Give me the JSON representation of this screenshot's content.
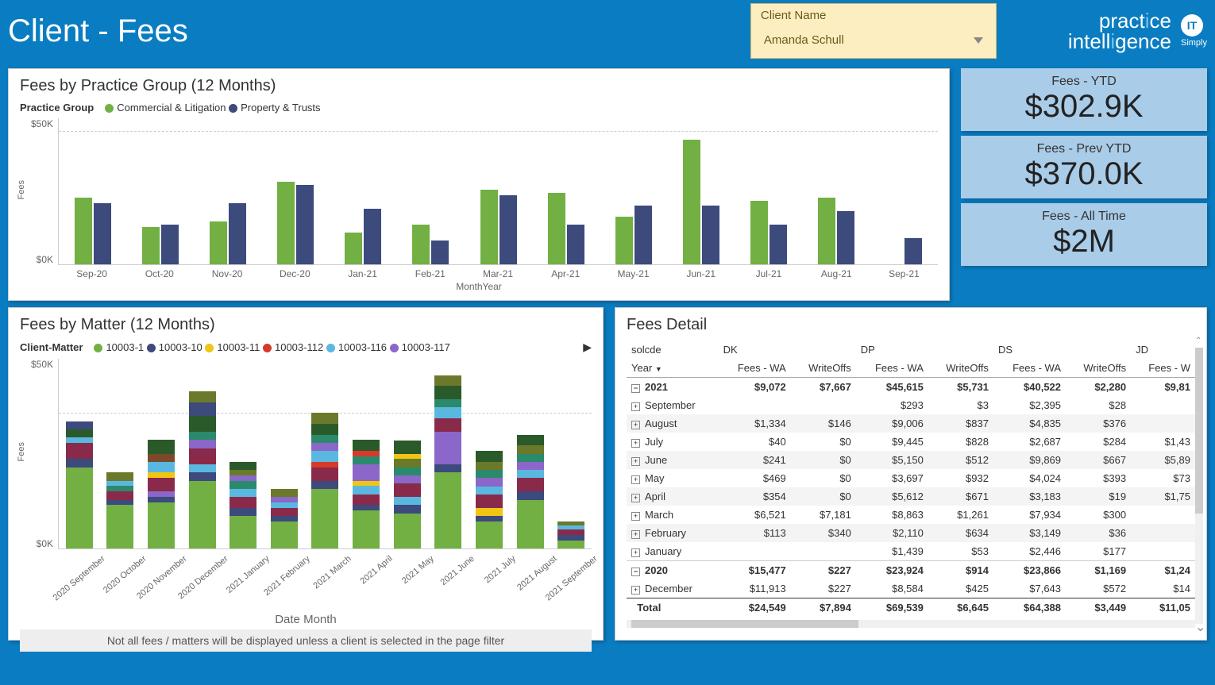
{
  "header": {
    "title": "Client - Fees",
    "filter_label": "Client Name",
    "filter_value": "Amanda Schull",
    "logo_line1_a": "pract",
    "logo_line1_b": "i",
    "logo_line1_c": "ce",
    "logo_line2_a": "intell",
    "logo_line2_b": "i",
    "logo_line2_c": "gence",
    "logo2_top": "IT",
    "logo2_bottom": "Simply"
  },
  "kpi": [
    {
      "title": "Fees - YTD",
      "value": "$302.9K"
    },
    {
      "title": "Fees - Prev YTD",
      "value": "$370.0K"
    },
    {
      "title": "Fees - All Time",
      "value": "$2M"
    }
  ],
  "chart1_title": "Fees by Practice Group (12 Months)",
  "chart1_legend_title": "Practice Group",
  "chart1_xlabel": "MonthYear",
  "chart1_ylabel": "Fees",
  "chart2_title": "Fees by Matter (12 Months)",
  "chart2_legend_title": "Client-Matter",
  "chart2_xlabel": "Date Month",
  "chart2_ylabel": "Fees",
  "chart2_footer": "Not all fees / matters will be displayed unless a client is selected in the page filter",
  "fees_detail_title": "Fees Detail",
  "colors": {
    "green": "#72b043",
    "navy": "#3c4a7c",
    "yellow": "#f0c514",
    "red": "#d63a2a",
    "sky": "#5ab8e0",
    "purple": "#8a67c8",
    "teal": "#2a8a6b",
    "brown": "#7a4a2a",
    "maroon": "#8a2a4a",
    "olive": "#6a7a2a",
    "dkgreen": "#2a5a2a"
  },
  "chart_data": {
    "chart1": {
      "type": "bar",
      "ylabel": "Fees",
      "xlabel": "MonthYear",
      "yticks": [
        "$0K",
        "$50K"
      ],
      "ylim": [
        0,
        55000
      ],
      "categories": [
        "Sep-20",
        "Oct-20",
        "Nov-20",
        "Dec-20",
        "Jan-21",
        "Feb-21",
        "Mar-21",
        "Apr-21",
        "May-21",
        "Jun-21",
        "Jul-21",
        "Aug-21",
        "Sep-21"
      ],
      "series": [
        {
          "name": "Commercial & Litigation",
          "color": "green",
          "values": [
            25000,
            14000,
            16000,
            31000,
            12000,
            15000,
            28000,
            27000,
            18000,
            47000,
            24000,
            25000,
            0
          ]
        },
        {
          "name": "Property & Trusts",
          "color": "navy",
          "values": [
            23000,
            15000,
            23000,
            30000,
            21000,
            9000,
            26000,
            15000,
            22000,
            22000,
            15000,
            20000,
            10000
          ]
        }
      ]
    },
    "chart2": {
      "type": "bar_stacked",
      "ylabel": "Fees",
      "xlabel": "Date Month",
      "yticks": [
        "$0K",
        "$50K"
      ],
      "ylim": [
        0,
        70000
      ],
      "categories": [
        "2020 September",
        "2020 October",
        "2020 November",
        "2020 December",
        "2021 January",
        "2021 February",
        "2021 March",
        "2021 April",
        "2021 May",
        "2021 June",
        "2021 July",
        "2021 August",
        "2021 September"
      ],
      "legend": [
        {
          "name": "10003-1",
          "color": "green"
        },
        {
          "name": "10003-10",
          "color": "navy"
        },
        {
          "name": "10003-11",
          "color": "yellow"
        },
        {
          "name": "10003-112",
          "color": "red"
        },
        {
          "name": "10003-116",
          "color": "sky"
        },
        {
          "name": "10003-117",
          "color": "purple"
        }
      ],
      "stacks": [
        {
          "total": 47000,
          "segs": [
            {
              "c": "green",
              "v": 30000
            },
            {
              "c": "navy",
              "v": 3000
            },
            {
              "c": "maroon",
              "v": 6000
            },
            {
              "c": "sky",
              "v": 2000
            },
            {
              "c": "dkgreen",
              "v": 3000
            },
            {
              "c": "navy",
              "v": 3000
            }
          ]
        },
        {
          "total": 28000,
          "segs": [
            {
              "c": "green",
              "v": 16000
            },
            {
              "c": "navy",
              "v": 2000
            },
            {
              "c": "maroon",
              "v": 3000
            },
            {
              "c": "teal",
              "v": 2000
            },
            {
              "c": "sky",
              "v": 2000
            },
            {
              "c": "olive",
              "v": 3000
            }
          ]
        },
        {
          "total": 40000,
          "segs": [
            {
              "c": "green",
              "v": 17000
            },
            {
              "c": "navy",
              "v": 2000
            },
            {
              "c": "purple",
              "v": 2000
            },
            {
              "c": "maroon",
              "v": 5000
            },
            {
              "c": "yellow",
              "v": 2000
            },
            {
              "c": "sky",
              "v": 4000
            },
            {
              "c": "brown",
              "v": 3000
            },
            {
              "c": "dkgreen",
              "v": 5000
            }
          ]
        },
        {
          "total": 58000,
          "segs": [
            {
              "c": "green",
              "v": 25000
            },
            {
              "c": "navy",
              "v": 3000
            },
            {
              "c": "sky",
              "v": 3000
            },
            {
              "c": "maroon",
              "v": 6000
            },
            {
              "c": "purple",
              "v": 3000
            },
            {
              "c": "teal",
              "v": 3000
            },
            {
              "c": "dkgreen",
              "v": 6000
            },
            {
              "c": "navy",
              "v": 5000
            },
            {
              "c": "olive",
              "v": 4000
            }
          ]
        },
        {
          "total": 32000,
          "segs": [
            {
              "c": "green",
              "v": 12000
            },
            {
              "c": "navy",
              "v": 3000
            },
            {
              "c": "maroon",
              "v": 4000
            },
            {
              "c": "sky",
              "v": 3000
            },
            {
              "c": "teal",
              "v": 3000
            },
            {
              "c": "purple",
              "v": 2000
            },
            {
              "c": "olive",
              "v": 2000
            },
            {
              "c": "dkgreen",
              "v": 3000
            }
          ]
        },
        {
          "total": 22000,
          "segs": [
            {
              "c": "green",
              "v": 10000
            },
            {
              "c": "navy",
              "v": 2000
            },
            {
              "c": "maroon",
              "v": 3000
            },
            {
              "c": "sky",
              "v": 2000
            },
            {
              "c": "purple",
              "v": 2000
            },
            {
              "c": "olive",
              "v": 3000
            }
          ]
        },
        {
          "total": 50000,
          "segs": [
            {
              "c": "green",
              "v": 22000
            },
            {
              "c": "navy",
              "v": 3000
            },
            {
              "c": "maroon",
              "v": 5000
            },
            {
              "c": "red",
              "v": 2000
            },
            {
              "c": "sky",
              "v": 4000
            },
            {
              "c": "purple",
              "v": 3000
            },
            {
              "c": "teal",
              "v": 3000
            },
            {
              "c": "dkgreen",
              "v": 4000
            },
            {
              "c": "olive",
              "v": 4000
            }
          ]
        },
        {
          "total": 40000,
          "segs": [
            {
              "c": "green",
              "v": 14000
            },
            {
              "c": "navy",
              "v": 2000
            },
            {
              "c": "maroon",
              "v": 4000
            },
            {
              "c": "sky",
              "v": 3000
            },
            {
              "c": "yellow",
              "v": 2000
            },
            {
              "c": "purple",
              "v": 6000
            },
            {
              "c": "teal",
              "v": 3000
            },
            {
              "c": "red",
              "v": 2000
            },
            {
              "c": "dkgreen",
              "v": 4000
            }
          ]
        },
        {
          "total": 40000,
          "segs": [
            {
              "c": "green",
              "v": 13000
            },
            {
              "c": "navy",
              "v": 3000
            },
            {
              "c": "sky",
              "v": 3000
            },
            {
              "c": "maroon",
              "v": 5000
            },
            {
              "c": "purple",
              "v": 3000
            },
            {
              "c": "teal",
              "v": 3000
            },
            {
              "c": "olive",
              "v": 3000
            },
            {
              "c": "yellow",
              "v": 2000
            },
            {
              "c": "dkgreen",
              "v": 5000
            }
          ]
        },
        {
          "total": 64000,
          "segs": [
            {
              "c": "green",
              "v": 28000
            },
            {
              "c": "navy",
              "v": 3000
            },
            {
              "c": "purple",
              "v": 12000
            },
            {
              "c": "maroon",
              "v": 5000
            },
            {
              "c": "sky",
              "v": 4000
            },
            {
              "c": "teal",
              "v": 3000
            },
            {
              "c": "dkgreen",
              "v": 5000
            },
            {
              "c": "olive",
              "v": 4000
            }
          ]
        },
        {
          "total": 36000,
          "segs": [
            {
              "c": "green",
              "v": 10000
            },
            {
              "c": "navy",
              "v": 2000
            },
            {
              "c": "yellow",
              "v": 3000
            },
            {
              "c": "maroon",
              "v": 5000
            },
            {
              "c": "sky",
              "v": 3000
            },
            {
              "c": "purple",
              "v": 3000
            },
            {
              "c": "teal",
              "v": 3000
            },
            {
              "c": "olive",
              "v": 3000
            },
            {
              "c": "dkgreen",
              "v": 4000
            }
          ]
        },
        {
          "total": 42000,
          "segs": [
            {
              "c": "green",
              "v": 18000
            },
            {
              "c": "navy",
              "v": 3000
            },
            {
              "c": "maroon",
              "v": 5000
            },
            {
              "c": "sky",
              "v": 3000
            },
            {
              "c": "purple",
              "v": 3000
            },
            {
              "c": "teal",
              "v": 3000
            },
            {
              "c": "olive",
              "v": 3000
            },
            {
              "c": "dkgreen",
              "v": 4000
            }
          ]
        },
        {
          "total": 10000,
          "segs": [
            {
              "c": "green",
              "v": 3000
            },
            {
              "c": "navy",
              "v": 2000
            },
            {
              "c": "maroon",
              "v": 2000
            },
            {
              "c": "sky",
              "v": 1500
            },
            {
              "c": "olive",
              "v": 1500
            }
          ]
        }
      ]
    }
  },
  "detail": {
    "top_left": "solcde",
    "row_header": "Year",
    "groups": [
      "DK",
      "DP",
      "DS",
      "JD"
    ],
    "sub_cols": [
      "Fees - WA",
      "WriteOffs"
    ],
    "last_partial": "Fees - W",
    "rows": [
      {
        "type": "year",
        "exp": "−",
        "label": "2021",
        "vals": [
          "$9,072",
          "$7,667",
          "$45,615",
          "$5,731",
          "$40,522",
          "$2,280",
          "$9,81"
        ]
      },
      {
        "type": "month",
        "exp": "+",
        "label": "September",
        "vals": [
          "",
          "",
          "$293",
          "$3",
          "$2,395",
          "$28",
          ""
        ]
      },
      {
        "type": "month",
        "exp": "+",
        "label": "August",
        "vals": [
          "$1,334",
          "$146",
          "$9,006",
          "$837",
          "$4,835",
          "$376",
          ""
        ]
      },
      {
        "type": "month",
        "exp": "+",
        "label": "July",
        "vals": [
          "$40",
          "$0",
          "$9,445",
          "$828",
          "$2,687",
          "$284",
          "$1,43"
        ]
      },
      {
        "type": "month",
        "exp": "+",
        "label": "June",
        "vals": [
          "$241",
          "$0",
          "$5,150",
          "$512",
          "$9,869",
          "$667",
          "$5,89"
        ]
      },
      {
        "type": "month",
        "exp": "+",
        "label": "May",
        "vals": [
          "$469",
          "$0",
          "$3,697",
          "$932",
          "$4,024",
          "$393",
          "$73"
        ]
      },
      {
        "type": "month",
        "exp": "+",
        "label": "April",
        "vals": [
          "$354",
          "$0",
          "$5,612",
          "$671",
          "$3,183",
          "$19",
          "$1,75"
        ]
      },
      {
        "type": "month",
        "exp": "+",
        "label": "March",
        "vals": [
          "$6,521",
          "$7,181",
          "$8,863",
          "$1,261",
          "$7,934",
          "$300",
          ""
        ]
      },
      {
        "type": "month",
        "exp": "+",
        "label": "February",
        "vals": [
          "$113",
          "$340",
          "$2,110",
          "$634",
          "$3,149",
          "$36",
          ""
        ]
      },
      {
        "type": "month",
        "exp": "+",
        "label": "January",
        "vals": [
          "",
          "",
          "$1,439",
          "$53",
          "$2,446",
          "$177",
          ""
        ]
      },
      {
        "type": "year",
        "exp": "−",
        "label": "2020",
        "vals": [
          "$15,477",
          "$227",
          "$23,924",
          "$914",
          "$23,866",
          "$1,169",
          "$1,24"
        ]
      },
      {
        "type": "month",
        "exp": "+",
        "label": "December",
        "vals": [
          "$11,913",
          "$227",
          "$8,584",
          "$425",
          "$7,643",
          "$572",
          "$14"
        ]
      },
      {
        "type": "total",
        "label": "Total",
        "vals": [
          "$24,549",
          "$7,894",
          "$69,539",
          "$6,645",
          "$64,388",
          "$3,449",
          "$11,05"
        ]
      }
    ]
  }
}
